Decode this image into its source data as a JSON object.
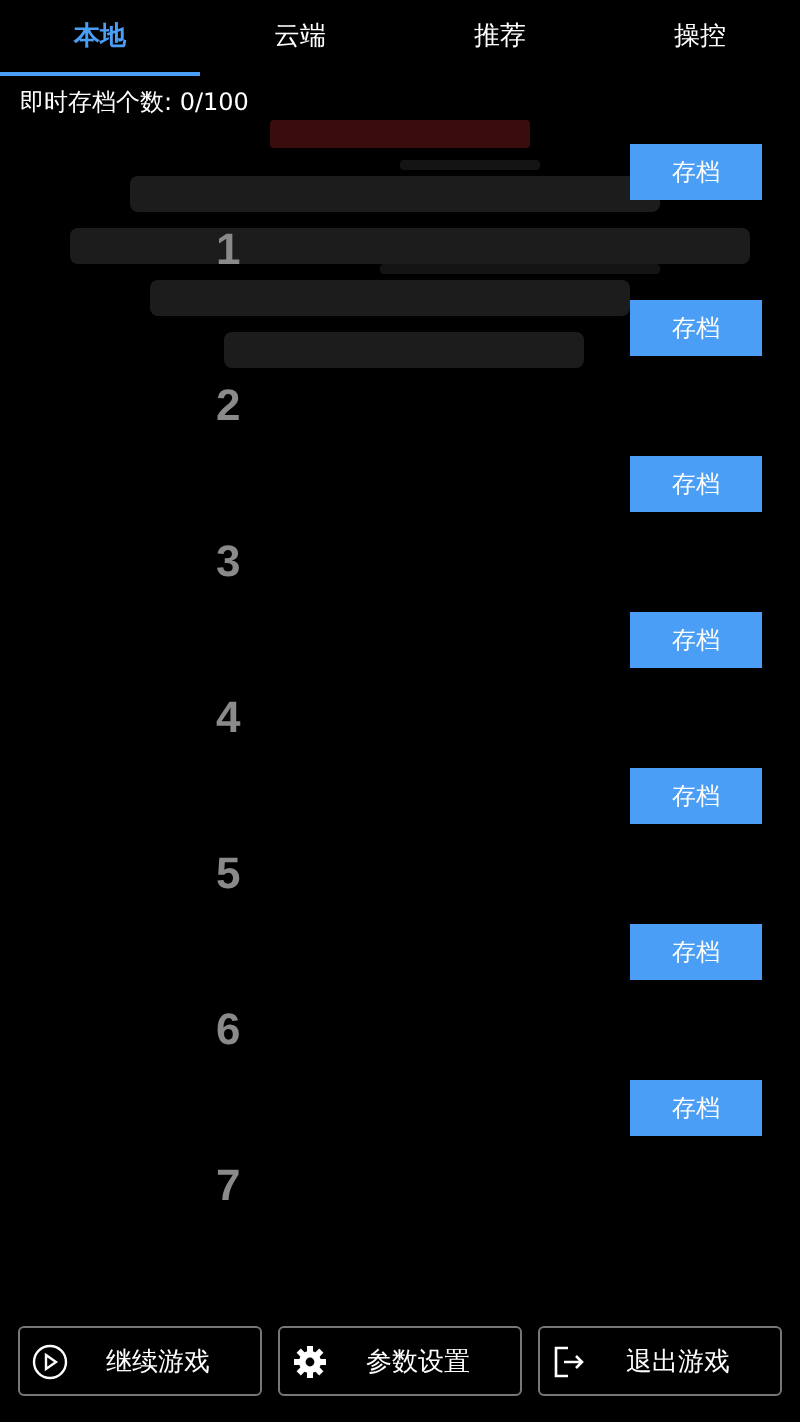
{
  "tabs": [
    {
      "label": "本地",
      "selected": true
    },
    {
      "label": "云端",
      "selected": false
    },
    {
      "label": "推荐",
      "selected": false
    },
    {
      "label": "操控",
      "selected": false
    }
  ],
  "save_count": "即时存档个数: 0/100",
  "slots": [
    {
      "number": "1",
      "button": "存档"
    },
    {
      "number": "2",
      "button": "存档"
    },
    {
      "number": "3",
      "button": "存档"
    },
    {
      "number": "4",
      "button": "存档"
    },
    {
      "number": "5",
      "button": "存档"
    },
    {
      "number": "6",
      "button": "存档"
    },
    {
      "number": "7",
      "button": "存档"
    }
  ],
  "bottom_buttons": [
    {
      "kind": "play",
      "label": "继续游戏"
    },
    {
      "kind": "settings",
      "label": "参数设置"
    },
    {
      "kind": "exit",
      "label": "退出游戏"
    }
  ]
}
